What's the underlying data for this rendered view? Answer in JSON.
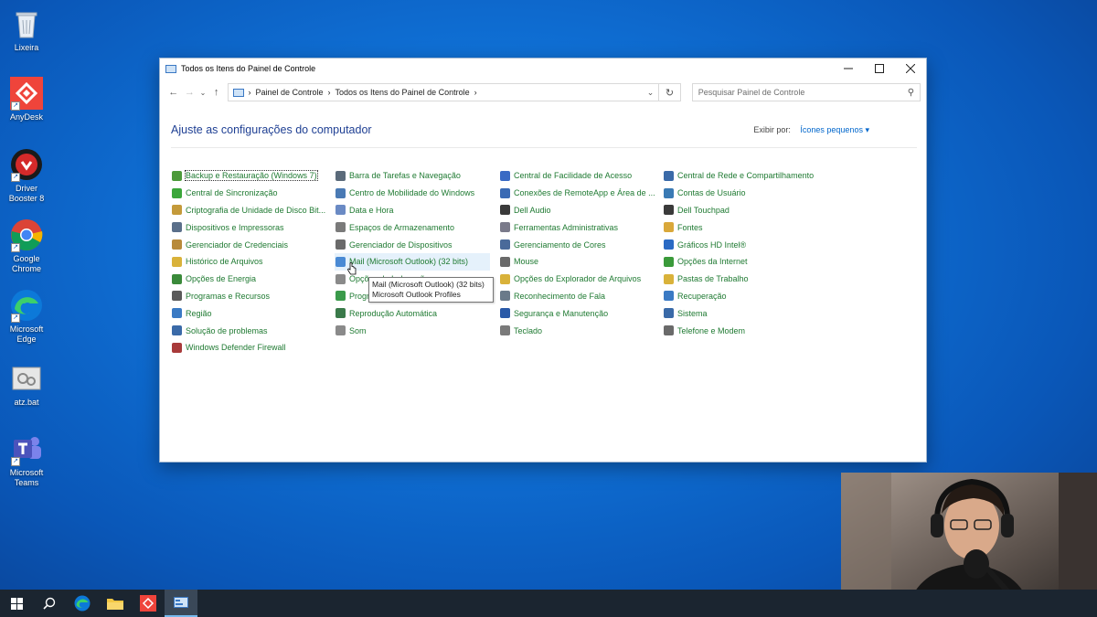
{
  "desktop": {
    "icons": [
      {
        "label": "Lixeira",
        "icon": "recycle-bin-icon"
      },
      {
        "label": "AnyDesk",
        "icon": "anydesk-icon"
      },
      {
        "label": "Driver Booster 8",
        "icon": "driver-booster-icon"
      },
      {
        "label": "Google Chrome",
        "icon": "chrome-icon"
      },
      {
        "label": "Microsoft Edge",
        "icon": "edge-icon"
      },
      {
        "label": "atz.bat",
        "icon": "batch-file-icon"
      },
      {
        "label": "Microsoft Teams",
        "icon": "teams-icon"
      }
    ]
  },
  "window": {
    "title": "Todos os Itens do Painel de Controle",
    "breadcrumb": [
      "Painel de Controle",
      "Todos os Itens do Painel de Controle"
    ],
    "search_placeholder": "Pesquisar Painel de Controle",
    "heading": "Ajuste as configurações do computador",
    "view_by_label": "Exibir por:",
    "view_by_value": "Ícones pequenos",
    "columns": [
      [
        {
          "label": "Backup e Restauração (Windows 7)",
          "color": "#4c9a3a"
        },
        {
          "label": "Central de Sincronização",
          "color": "#3aa63a"
        },
        {
          "label": "Criptografia de Unidade de Disco Bit...",
          "color": "#c49a3a"
        },
        {
          "label": "Dispositivos e Impressoras",
          "color": "#5a6f8a"
        },
        {
          "label": "Gerenciador de Credenciais",
          "color": "#b88a3a"
        },
        {
          "label": "Histórico de Arquivos",
          "color": "#d9b23a"
        },
        {
          "label": "Opções de Energia",
          "color": "#3a8a3a"
        },
        {
          "label": "Programas e Recursos",
          "color": "#5a5a5a"
        },
        {
          "label": "Região",
          "color": "#3a7ac4"
        },
        {
          "label": "Solução de problemas",
          "color": "#3a6aa8"
        },
        {
          "label": "Windows Defender Firewall",
          "color": "#a83a3a"
        }
      ],
      [
        {
          "label": "Barra de Tarefas e Navegação",
          "color": "#5a6a7a"
        },
        {
          "label": "Centro de Mobilidade do Windows",
          "color": "#4a7ab4"
        },
        {
          "label": "Data e Hora",
          "color": "#6a8ac4"
        },
        {
          "label": "Espaços de Armazenamento",
          "color": "#7a7a7a"
        },
        {
          "label": "Gerenciador de Dispositivos",
          "color": "#6a6a6a"
        },
        {
          "label": "Mail (Microsoft Outlook) (32 bits)",
          "color": "#4a8ad4"
        },
        {
          "label": "Opções de Indexação",
          "color": "#8a8a8a"
        },
        {
          "label": "Programas Padrão",
          "color": "#3a9a4a"
        },
        {
          "label": "Reprodução Automática",
          "color": "#3a7a4a"
        },
        {
          "label": "Som",
          "color": "#8a8a8a"
        }
      ],
      [
        {
          "label": "Central de Facilidade de Acesso",
          "color": "#3a6ac4"
        },
        {
          "label": "Conexões de RemoteApp e Área de ...",
          "color": "#3a6ab4"
        },
        {
          "label": "Dell Audio",
          "color": "#3a3a3a"
        },
        {
          "label": "Ferramentas Administrativas",
          "color": "#7a7a8a"
        },
        {
          "label": "Gerenciamento de Cores",
          "color": "#4a6a9a"
        },
        {
          "label": "Mouse",
          "color": "#6a6a6a"
        },
        {
          "label": "Opções do Explorador de Arquivos",
          "color": "#d9b23a"
        },
        {
          "label": "Reconhecimento de Fala",
          "color": "#6a7a8a"
        },
        {
          "label": "Segurança e Manutenção",
          "color": "#2a5aa8"
        },
        {
          "label": "Teclado",
          "color": "#7a7a7a"
        }
      ],
      [
        {
          "label": "Central de Rede e Compartilhamento",
          "color": "#3a6aa8"
        },
        {
          "label": "Contas de Usuário",
          "color": "#3a7ab4"
        },
        {
          "label": "Dell Touchpad",
          "color": "#3a3a3a"
        },
        {
          "label": "Fontes",
          "color": "#d9a83a"
        },
        {
          "label": "Gráficos HD Intel®",
          "color": "#2a6ac4"
        },
        {
          "label": "Opções da Internet",
          "color": "#3a9a3a"
        },
        {
          "label": "Pastas de Trabalho",
          "color": "#d9b23a"
        },
        {
          "label": "Recuperação",
          "color": "#3a7ac4"
        },
        {
          "label": "Sistema",
          "color": "#3a6aa8"
        },
        {
          "label": "Telefone e Modem",
          "color": "#6a6a6a"
        }
      ]
    ]
  },
  "tooltip": {
    "line1": "Mail (Microsoft Outlook) (32 bits)",
    "line2": "Microsoft Outlook Profiles"
  },
  "taskbar": {
    "items": [
      "windows-start-icon",
      "search-icon",
      "edge-icon",
      "file-explorer-icon",
      "anydesk-icon",
      "control-panel-icon"
    ]
  }
}
